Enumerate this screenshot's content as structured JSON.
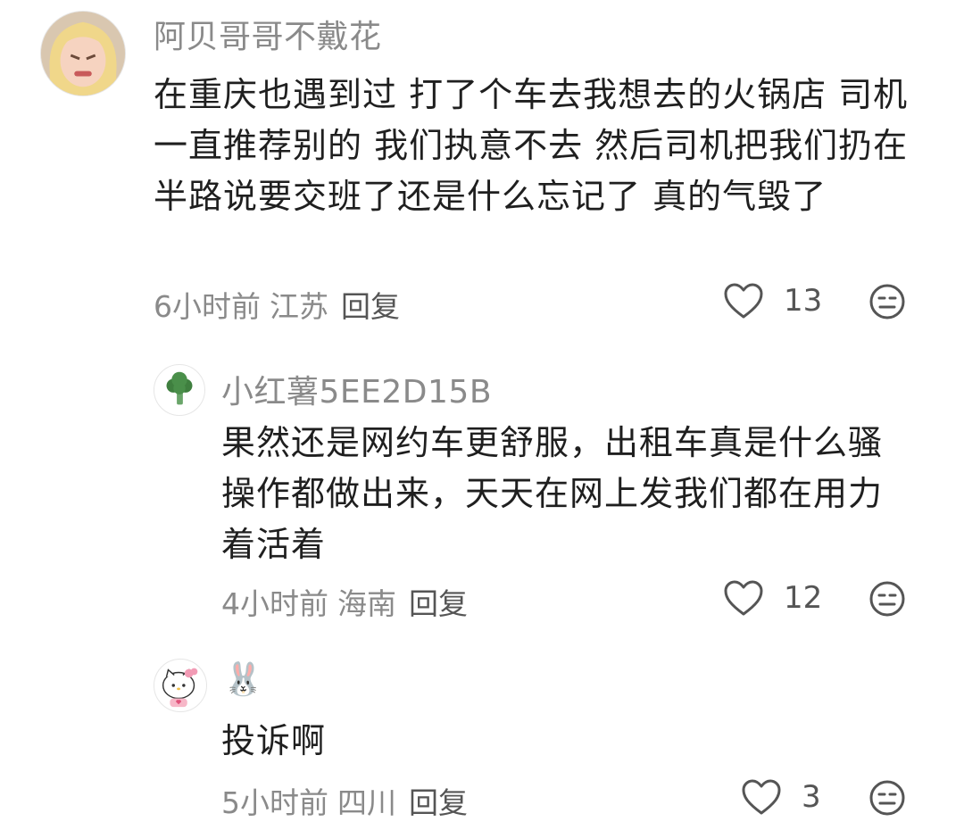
{
  "comments": [
    {
      "username": "阿贝哥哥不戴花",
      "text": "在重庆也遇到过 打了个车去我想去的火锅店 司机一直推荐别的 我们执意不去 然后司机把我们扔在半路说要交班了还是什么忘记了 真的气毁了",
      "time": "6小时前",
      "location": "江苏",
      "reply_label": "回复",
      "likes": "13",
      "avatar_icon": "girl-photo-avatar"
    },
    {
      "username": "小红薯5EE2D15B",
      "text": "果然还是网约车更舒服，出租车真是什么骚操作都做出来，天天在网上发我们都在用力着活着",
      "time": "4小时前",
      "location": "海南",
      "reply_label": "回复",
      "likes": "12",
      "avatar_icon": "broccoli-avatar"
    },
    {
      "username": "🐰",
      "text": "投诉啊",
      "time": "5小时前",
      "location": "四川",
      "reply_label": "回复",
      "likes": "3",
      "avatar_icon": "hello-kitty-avatar"
    }
  ],
  "colors": {
    "text_primary": "#1f1f1f",
    "text_secondary": "#8a8a8a",
    "icon": "#555555"
  }
}
